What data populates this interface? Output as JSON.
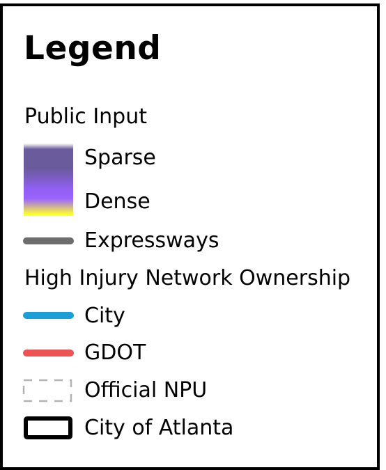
{
  "legend": {
    "title": "Legend",
    "public_input": {
      "heading": "Public Input",
      "sparse_label": "Sparse",
      "dense_label": "Dense",
      "gradient_colors": [
        "#ffffff",
        "#6a5b9d",
        "#8f60f0",
        "#9a63ff",
        "#ffff2a"
      ]
    },
    "expressways": {
      "label": "Expressways",
      "color": "#6d6d6d"
    },
    "hin_ownership": {
      "heading": "High Injury Network Ownership",
      "items": [
        {
          "label": "City",
          "color": "#1a9fd8"
        },
        {
          "label": "GDOT",
          "color": "#ee5353"
        }
      ]
    },
    "official_npu": {
      "label": "Official NPU",
      "color": "#b3b3b3"
    },
    "city_of_atlanta": {
      "label": "City of Atlanta",
      "color": "#000000"
    }
  }
}
